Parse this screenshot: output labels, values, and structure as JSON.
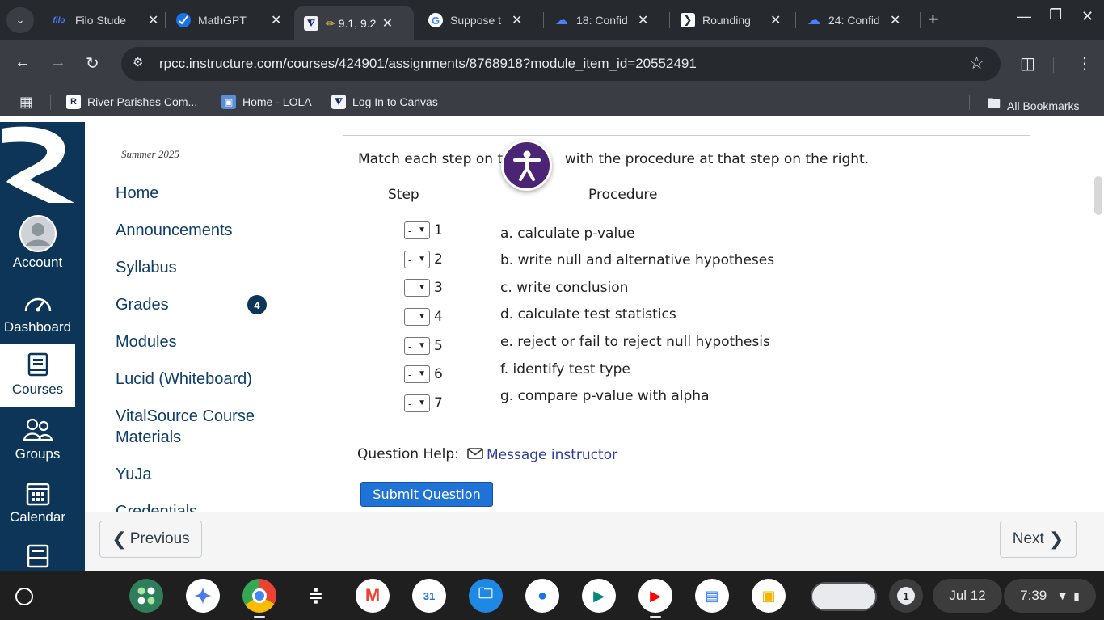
{
  "browser": {
    "tabs": [
      {
        "title": "Filo Stude",
        "favicon": "filo-icon",
        "favicon_text": "filo"
      },
      {
        "title": "MathGPT",
        "favicon": "mathgpt-icon"
      },
      {
        "title": "9.1, 9.2",
        "favicon": "lctcs-icon",
        "active": true
      },
      {
        "title": "Suppose t",
        "favicon": "google-icon",
        "favicon_text": "G"
      },
      {
        "title": "18: Confid",
        "favicon": "cloud-icon"
      },
      {
        "title": "Rounding",
        "favicon": "rounding-icon"
      },
      {
        "title": "24: Confid",
        "favicon": "cloud-icon"
      }
    ],
    "new_tab": "+",
    "url": "rpcc.instructure.com/courses/424901/assignments/8768918?module_item_id=20552491",
    "bookmarks": [
      {
        "label": "River Parishes Com...",
        "icon": "rpcc-icon"
      },
      {
        "label": "Home - LOLA",
        "icon": "lola-icon"
      },
      {
        "label": "Log In to Canvas",
        "icon": "lctcs-icon"
      }
    ],
    "all_bookmarks": "All Bookmarks"
  },
  "global_nav": {
    "items": [
      {
        "label": "Account",
        "icon": "avatar-icon"
      },
      {
        "label": "Dashboard",
        "icon": "dashboard-icon"
      },
      {
        "label": "Courses",
        "icon": "courses-icon",
        "active": true
      },
      {
        "label": "Groups",
        "icon": "groups-icon"
      },
      {
        "label": "Calendar",
        "icon": "calendar-icon"
      },
      {
        "label": "",
        "icon": "inbox-icon"
      }
    ]
  },
  "course_nav": {
    "term": "Summer 2025",
    "links": [
      "Home",
      "Announcements",
      "Syllabus",
      "Grades",
      "Modules",
      "Lucid (Whiteboard)",
      "VitalSource Course Materials",
      "YuJa",
      "Credentials"
    ],
    "grades_badge": "4"
  },
  "question": {
    "instruction_before": "Match each step on th",
    "instruction_after": "with the procedure at that step on the right.",
    "step_header": "Step",
    "procedure_header": "Procedure",
    "steps": [
      {
        "number": "1",
        "selected": "-"
      },
      {
        "number": "2",
        "selected": "-"
      },
      {
        "number": "3",
        "selected": "-"
      },
      {
        "number": "4",
        "selected": "-"
      },
      {
        "number": "5",
        "selected": "-"
      },
      {
        "number": "6",
        "selected": "-"
      },
      {
        "number": "7",
        "selected": "-"
      }
    ],
    "procedures": [
      "a. calculate p-value",
      "b. write null and alternative hypotheses",
      "c. write conclusion",
      "d. calculate test statistics",
      "e. reject or fail to reject null hypothesis",
      "f. identify test type",
      "g. compare p-value with alpha"
    ],
    "help_label": "Question Help:",
    "message_link": "Message instructor",
    "submit_label": "Submit Question"
  },
  "footer": {
    "previous_label": "Previous",
    "next_label": "Next"
  },
  "shelf": {
    "notification_count": "1",
    "date": "Jul 12",
    "time": "7:39"
  },
  "colors": {
    "canvas_nav": "#0c3557",
    "link": "#2c3e9f",
    "submit": "#1f72d6",
    "a11y": "#4b2476"
  }
}
